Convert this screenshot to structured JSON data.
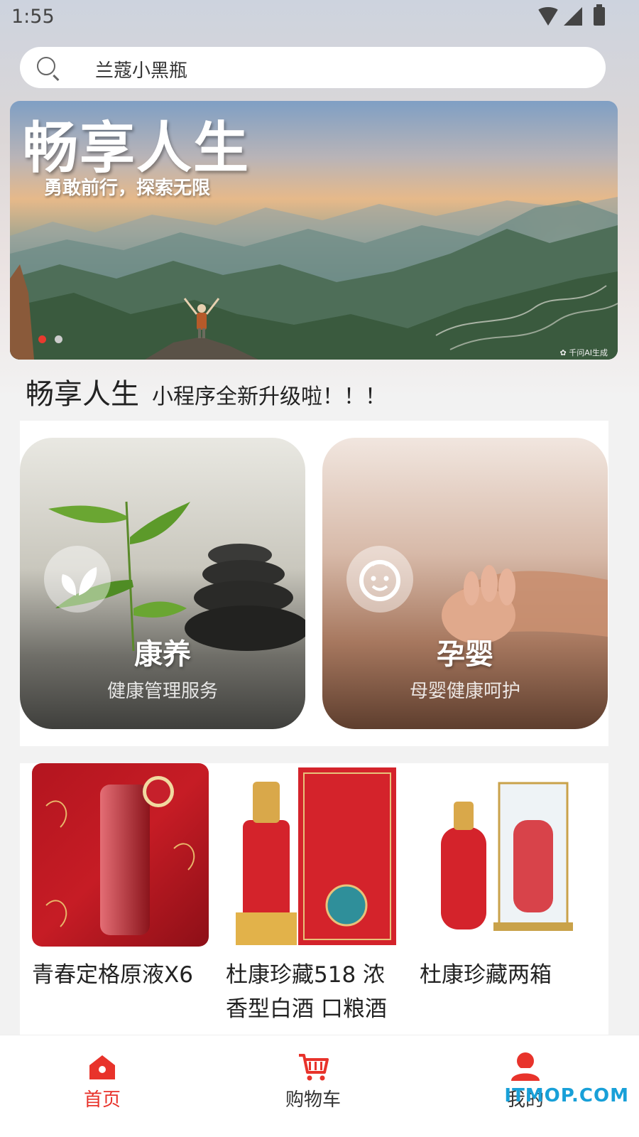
{
  "status_bar": {
    "time": "1:55"
  },
  "search": {
    "text": "兰蔻小黑瓶"
  },
  "banner": {
    "title": "畅享人生",
    "subtitle": "勇敢前行，探索无限",
    "watermark": "✿ 千问AI生成",
    "slide_count": 2,
    "active_slide": 1
  },
  "notice": {
    "title": "畅享人生",
    "text": "小程序全新升级啦！！！"
  },
  "services": [
    {
      "title": "康养",
      "subtitle": "健康管理服务",
      "icon": "leaf-icon"
    },
    {
      "title": "孕婴",
      "subtitle": "母婴健康呵护",
      "icon": "baby-face-icon"
    }
  ],
  "products": [
    {
      "name": "青春定格原液X6"
    },
    {
      "name": "杜康珍藏518 浓香型白酒 口粮酒"
    },
    {
      "name": "杜康珍藏两箱"
    }
  ],
  "tab_bar": {
    "home": "首页",
    "cart": "购物车",
    "mine": "我的",
    "active": "home",
    "active_color": "#e8332b"
  },
  "site_watermark": "ITMOP.COM"
}
